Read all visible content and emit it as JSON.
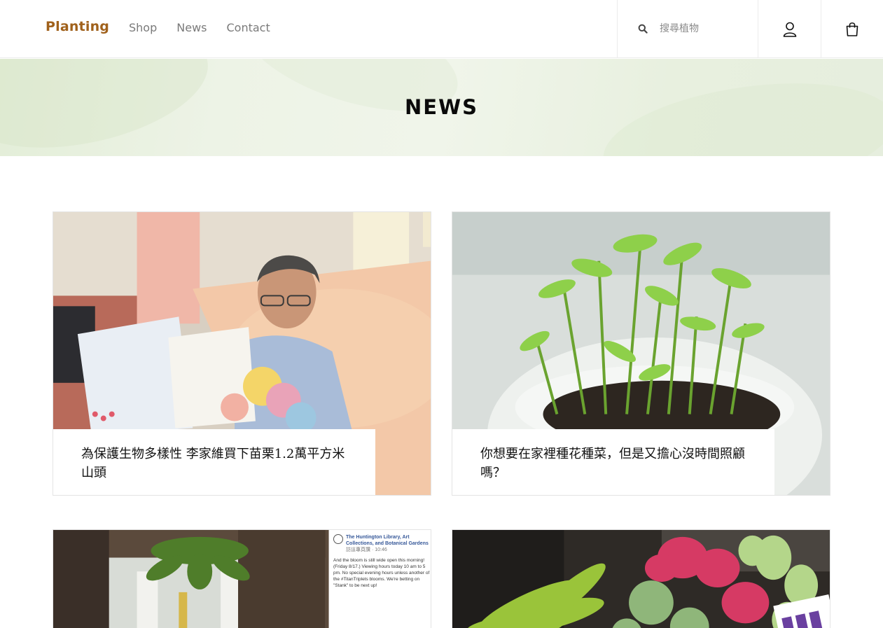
{
  "header": {
    "brand": "Planting",
    "nav": [
      "Shop",
      "News",
      "Contact"
    ],
    "search_placeholder": "搜尋植物"
  },
  "hero": {
    "title": "NEWS"
  },
  "articles": [
    {
      "title": "為保護生物多樣性 李家維買下苗栗1.2萬平方米山頭",
      "image": "elderly man in hospital bed holding a card"
    },
    {
      "title": "你想要在家裡種花種菜，但是又擔心沒時間照顧嗎？",
      "image": "seedlings sprouting in a white pot"
    },
    {
      "title": "",
      "image": "large tropical plant beside a social media post"
    },
    {
      "title": "",
      "image": "bananas, dragon fruit, custard apples and guavas"
    }
  ],
  "social_post": {
    "account": "The Huntington Library, Art Collections, and Botanical Gardens",
    "meta": "訪這專頁讚 · 10:46",
    "body": "And the bloom is still wide open this morning! (Friday 8/17.) Viewing hours today 10 am to 5 pm. No special evening hours unless another of the #TitanTriplets blooms. We're betting on \"Stank\" to be next up!"
  },
  "colors": {
    "brand": "#a0611b",
    "nav": "#7a7a7a",
    "hero_bg": "#e8f0df"
  }
}
